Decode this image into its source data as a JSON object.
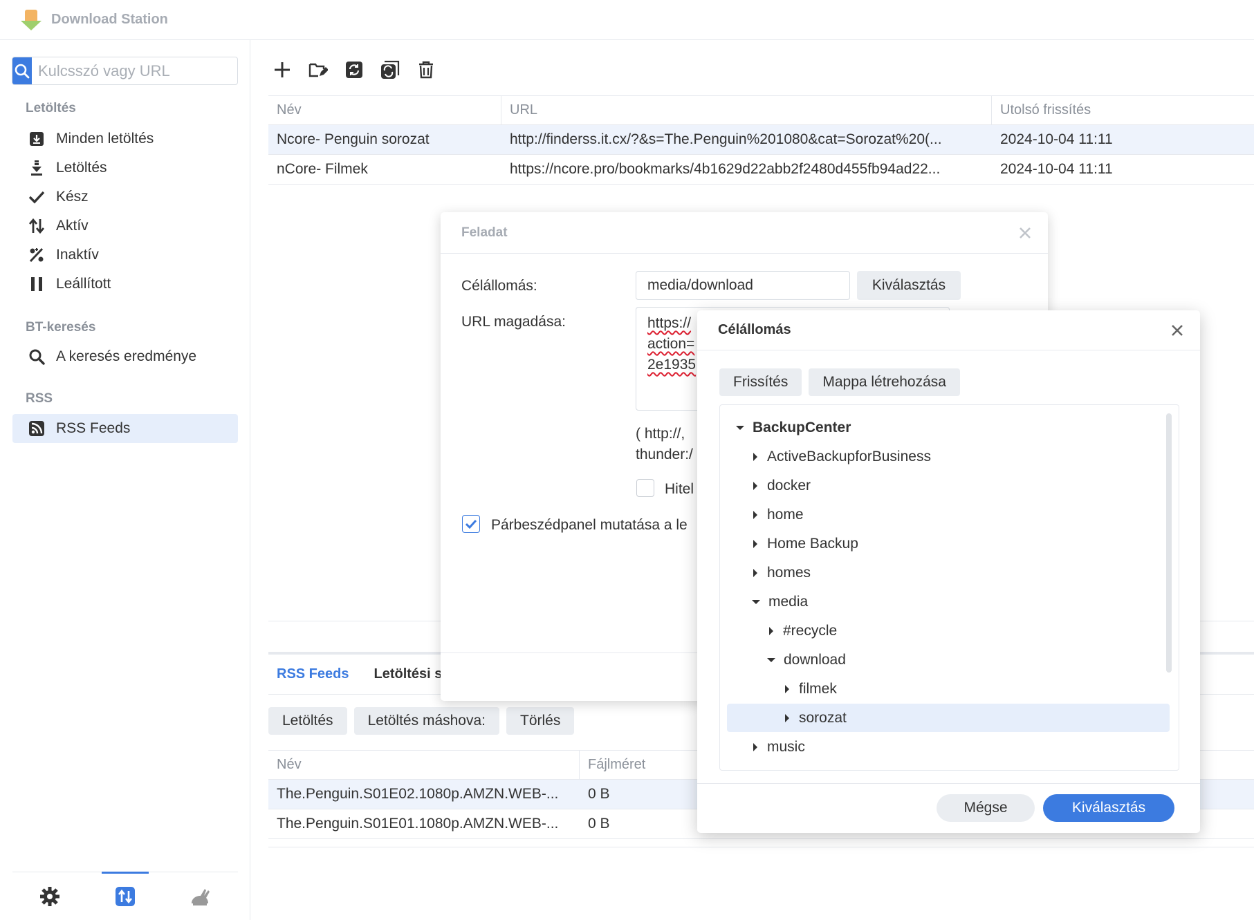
{
  "app": {
    "title": "Download Station"
  },
  "search": {
    "placeholder": "Kulcsszó vagy URL"
  },
  "sidebar": {
    "section_download": "Letöltés",
    "items": [
      {
        "label": "Minden letöltés",
        "icon": "download-box-icon"
      },
      {
        "label": "Letöltés",
        "icon": "download-arrow-icon"
      },
      {
        "label": "Kész",
        "icon": "check-icon"
      },
      {
        "label": "Aktív",
        "icon": "up-down-arrows-icon"
      },
      {
        "label": "Inaktív",
        "icon": "percent-icon"
      },
      {
        "label": "Leállított",
        "icon": "pause-icon"
      }
    ],
    "section_bt": "BT-keresés",
    "bt_item": "A keresés eredménye",
    "section_rss": "RSS",
    "rss_item": "RSS Feeds"
  },
  "feeds_table": {
    "columns": [
      "Név",
      "URL",
      "Utolsó frissítés"
    ],
    "rows": [
      {
        "name": "Ncore- Penguin sorozat",
        "url": "http://finderss.it.cx/?&s=The.Penguin%201080&cat=Sorozat%20(...",
        "updated": "2024-10-04 11:11"
      },
      {
        "name": "nCore- Filmek",
        "url": "https://ncore.pro/bookmarks/4b1629d22abb2f2480d455fb94ad22...",
        "updated": "2024-10-04 11:11"
      }
    ]
  },
  "lower": {
    "tabs": [
      "RSS Feeds",
      "Letöltési s"
    ],
    "actions": [
      "Letöltés",
      "Letöltés máshova:",
      "Törlés"
    ],
    "columns": [
      "Név",
      "Fájlméret"
    ],
    "rows": [
      {
        "name": "The.Penguin.S01E02.1080p.AMZN.WEB-...",
        "size": "0 B"
      },
      {
        "name": "The.Penguin.S01E01.1080p.AMZN.WEB-...",
        "size": "0 B"
      }
    ]
  },
  "task_dialog": {
    "title": "Feladat",
    "dest_label": "Célállomás:",
    "dest_value": "media/download",
    "select_label": "Kiválasztás",
    "url_label": "URL magadása:",
    "url_lines": [
      "https://",
      "action=",
      "2e1935"
    ],
    "hint_lines": [
      "( http://,",
      "thunder:/"
    ],
    "auth_label": "Hitel",
    "show_dialog_label": "Párbeszédpanel mutatása a le"
  },
  "dest_dialog": {
    "title": "Célállomás",
    "refresh": "Frissítés",
    "create_folder": "Mappa létrehozása",
    "tree": [
      {
        "label": "BackupCenter",
        "level": 0,
        "expanded": true,
        "bold": true
      },
      {
        "label": "ActiveBackupforBusiness",
        "level": 1,
        "expanded": false
      },
      {
        "label": "docker",
        "level": 1,
        "expanded": false
      },
      {
        "label": "home",
        "level": 1,
        "expanded": false
      },
      {
        "label": "Home Backup",
        "level": 1,
        "expanded": false
      },
      {
        "label": "homes",
        "level": 1,
        "expanded": false
      },
      {
        "label": "media",
        "level": 1,
        "expanded": true
      },
      {
        "label": "#recycle",
        "level": 2,
        "expanded": false
      },
      {
        "label": "download",
        "level": 2,
        "expanded": true
      },
      {
        "label": "filmek",
        "level": 3,
        "expanded": false
      },
      {
        "label": "sorozat",
        "level": 3,
        "expanded": false,
        "selected": true
      },
      {
        "label": "music",
        "level": 1,
        "expanded": false
      }
    ],
    "cancel": "Mégse",
    "confirm": "Kiválasztás"
  }
}
